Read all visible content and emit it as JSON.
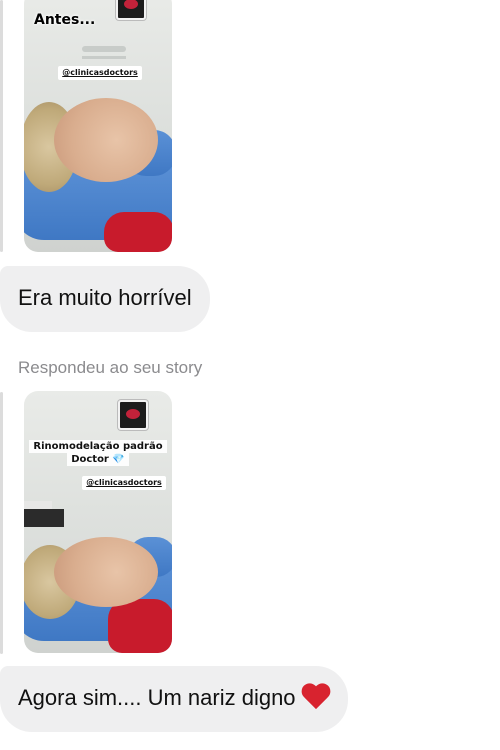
{
  "messages": [
    {
      "type": "story",
      "caption": "Antes...",
      "handle": "@clinicasdoctors"
    },
    {
      "type": "text",
      "text": "Era muito horrível"
    },
    {
      "type": "story_reply",
      "label": "Respondeu ao seu story",
      "caption_line1": "Rinomodelação padrão",
      "caption_line2": "Doctor 💎",
      "handle": "@clinicasdoctors"
    },
    {
      "type": "text",
      "text": "Agora sim.... Um nariz digno",
      "emoji": "heart-icon"
    }
  ],
  "colors": {
    "bubble": "#efeff0",
    "label": "#8b8b8e",
    "heart": "#d8232f",
    "pillow": "#3f78c4",
    "chair": "#c81b2c"
  }
}
